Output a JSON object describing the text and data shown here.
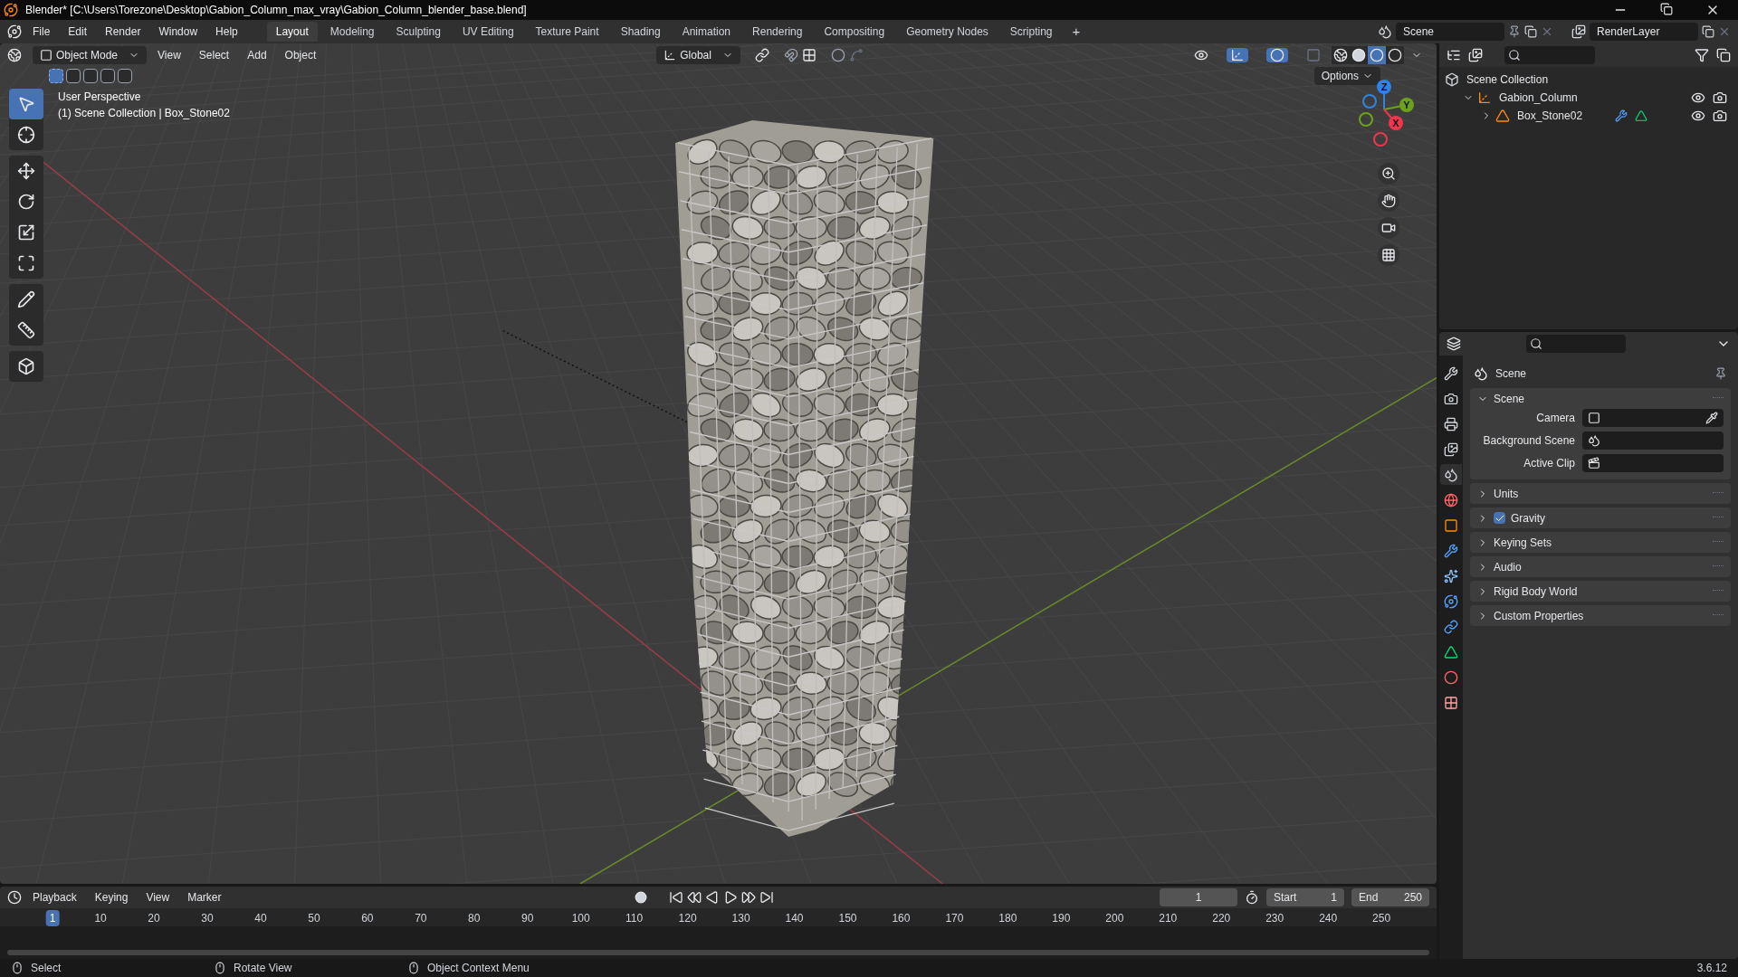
{
  "window": {
    "title": "Blender* [C:\\Users\\Torezone\\Desktop\\Gabion_Column_max_vray\\Gabion_Column_blender_base.blend]"
  },
  "menu": [
    "File",
    "Edit",
    "Render",
    "Window",
    "Help"
  ],
  "workspaces": [
    {
      "label": "Layout",
      "selected": true
    },
    {
      "label": "Modeling",
      "selected": false
    },
    {
      "label": "Sculpting",
      "selected": false
    },
    {
      "label": "UV Editing",
      "selected": false
    },
    {
      "label": "Texture Paint",
      "selected": false
    },
    {
      "label": "Shading",
      "selected": false
    },
    {
      "label": "Animation",
      "selected": false
    },
    {
      "label": "Rendering",
      "selected": false
    },
    {
      "label": "Compositing",
      "selected": false
    },
    {
      "label": "Geometry Nodes",
      "selected": false
    },
    {
      "label": "Scripting",
      "selected": false
    }
  ],
  "add_workspace": "+",
  "scene_field": {
    "value": "Scene"
  },
  "view_layer_field": {
    "value": "RenderLayer"
  },
  "viewport": {
    "gizmo_toggle": {
      "on": true
    },
    "overlay_toggle": {
      "on": true
    },
    "mode": "Object Mode",
    "menus": [
      "View",
      "Select",
      "Add",
      "Object"
    ],
    "orientation": "Global",
    "options": "Options",
    "select_modes": [
      {
        "selected": true
      },
      {
        "selected": false
      },
      {
        "selected": false
      },
      {
        "selected": false
      },
      {
        "selected": false
      }
    ],
    "overlay_text": [
      "User Perspective",
      "(1) Scene Collection | Box_Stone02"
    ],
    "shading": [
      {
        "kind": "wireframe",
        "selected": false
      },
      {
        "kind": "solid",
        "selected": false
      },
      {
        "kind": "material",
        "selected": true
      },
      {
        "kind": "rendered",
        "selected": false
      }
    ],
    "gizmo": [
      {
        "label": "Z",
        "color": "#2f83e3"
      },
      {
        "label": "Y",
        "color": "#6ca11b"
      },
      {
        "label": "X",
        "color": "#f0354f"
      }
    ],
    "tool_groups": [
      [
        {
          "kind": "select",
          "selected": true
        },
        {
          "kind": "cursor",
          "selected": false
        }
      ],
      [
        {
          "kind": "move",
          "selected": false
        },
        {
          "kind": "rotate",
          "selected": false
        },
        {
          "kind": "scale",
          "selected": false
        },
        {
          "kind": "transform",
          "selected": false
        }
      ],
      [
        {
          "kind": "annotate",
          "selected": false
        },
        {
          "kind": "measure",
          "selected": false
        }
      ],
      [
        {
          "kind": "add_cube",
          "selected": false
        }
      ]
    ]
  },
  "outliner": {
    "items": [
      {
        "label": "Scene Collection",
        "kind": "collection",
        "children": [
          {
            "label": "Gabion_Column",
            "kind": "empty",
            "expanded": true,
            "children": [
              {
                "label": "Box_Stone02",
                "kind": "mesh",
                "expanded": false
              }
            ]
          }
        ]
      }
    ]
  },
  "properties": {
    "tabs": [
      {
        "kind": "tool",
        "selected": false
      },
      {
        "kind": "render",
        "selected": false
      },
      {
        "kind": "output",
        "selected": false
      },
      {
        "kind": "view_layer",
        "selected": false
      },
      {
        "kind": "scene",
        "selected": true
      },
      {
        "kind": "world",
        "selected": false
      },
      {
        "kind": "object",
        "selected": false
      },
      {
        "kind": "modifiers",
        "selected": false
      },
      {
        "kind": "particles",
        "selected": false
      },
      {
        "kind": "physics",
        "selected": false
      },
      {
        "kind": "constraints",
        "selected": false
      },
      {
        "kind": "data",
        "selected": false
      },
      {
        "kind": "material",
        "selected": false
      },
      {
        "kind": "texture",
        "selected": false
      }
    ],
    "title": "Scene",
    "panels": [
      {
        "label": "Scene",
        "kind": "plain",
        "expanded": true,
        "fields": [
          {
            "label": "Camera",
            "kind": "camera"
          },
          {
            "label": "Background Scene",
            "kind": "scene"
          },
          {
            "label": "Active Clip",
            "kind": "clip"
          }
        ]
      },
      {
        "label": "Units",
        "kind": "plain",
        "expanded": false
      },
      {
        "label": "Gravity",
        "kind": "checkbox",
        "checked": true,
        "expanded": false
      },
      {
        "label": "Keying Sets",
        "kind": "plain",
        "expanded": false
      },
      {
        "label": "Audio",
        "kind": "plain",
        "expanded": false
      },
      {
        "label": "Rigid Body World",
        "kind": "plain",
        "expanded": false
      },
      {
        "label": "Custom Properties",
        "kind": "plain",
        "expanded": false
      }
    ]
  },
  "timeline": {
    "menus": [
      "Playback",
      "Keying",
      "View",
      "Marker"
    ],
    "current_frame": "1",
    "start_label": "Start",
    "start": "1",
    "end_label": "End",
    "end": "250",
    "ruler": [
      {
        "label": "1",
        "selected": true
      },
      {
        "label": "10",
        "selected": false
      },
      {
        "label": "20",
        "selected": false
      },
      {
        "label": "30",
        "selected": false
      },
      {
        "label": "40",
        "selected": false
      },
      {
        "label": "50",
        "selected": false
      },
      {
        "label": "60",
        "selected": false
      },
      {
        "label": "70",
        "selected": false
      },
      {
        "label": "80",
        "selected": false
      },
      {
        "label": "90",
        "selected": false
      },
      {
        "label": "100",
        "selected": false
      },
      {
        "label": "110",
        "selected": false
      },
      {
        "label": "120",
        "selected": false
      },
      {
        "label": "130",
        "selected": false
      },
      {
        "label": "140",
        "selected": false
      },
      {
        "label": "150",
        "selected": false
      },
      {
        "label": "160",
        "selected": false
      },
      {
        "label": "170",
        "selected": false
      },
      {
        "label": "180",
        "selected": false
      },
      {
        "label": "190",
        "selected": false
      },
      {
        "label": "200",
        "selected": false
      },
      {
        "label": "210",
        "selected": false
      },
      {
        "label": "220",
        "selected": false
      },
      {
        "label": "230",
        "selected": false
      },
      {
        "label": "240",
        "selected": false
      },
      {
        "label": "250",
        "selected": false
      }
    ]
  },
  "status_bar": {
    "items": [
      "Select",
      "Rotate View",
      "Object Context Menu"
    ],
    "version": "3.6.12"
  }
}
